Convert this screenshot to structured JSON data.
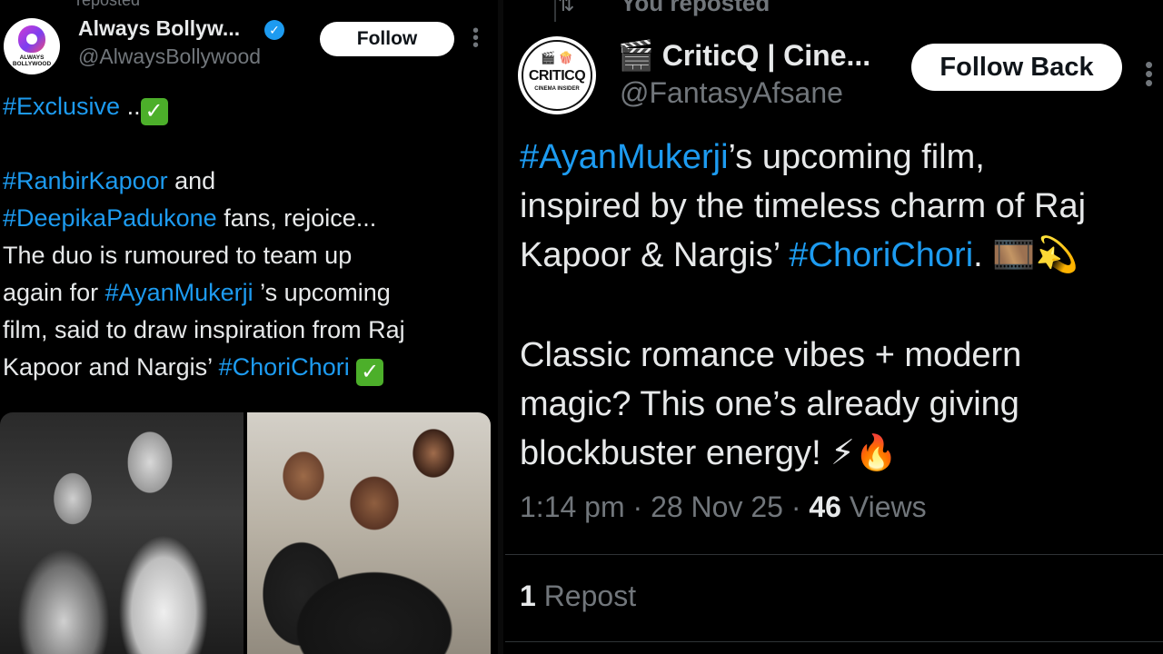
{
  "left_tweet": {
    "header_cut": "reposted",
    "avatar_text": "ALWAYS BOLLYWOOD",
    "name": "Always Bollyw...",
    "verified_icon": "verified-badge",
    "handle": "@AlwaysBollywood",
    "follow_label": "Follow",
    "more_icon": "more-vertical",
    "line1_tag": "#Exclusive",
    "line1_rest": " ..",
    "line2_tag": "#RanbirKapoor",
    "line2_rest": " and",
    "line3_tag": "#DeepikaPadukone",
    "line3_rest": " fans, rejoice...",
    "line4": "The duo is rumoured to team up",
    "line5_pre": "again for ",
    "line5_tag": "#AyanMukerji",
    "line5_rest": " ’s upcoming",
    "line6": "film, said to draw inspiration from Raj",
    "line7_pre": "Kapoor and Nargis’ ",
    "line7_tag": "#ChoriChori",
    "check_mark": "✓"
  },
  "right_tweet": {
    "repost_icon": "repost-icon",
    "reposted_label": "You reposted",
    "avatar_icons": "🎬 🍿",
    "avatar_text": "CRITICQ",
    "avatar_sub": "CINEMA INSIDER",
    "name_emoji": "🎬",
    "name": "CriticQ | Cine...",
    "handle": "@FantasyAfsane",
    "follow_label": "Follow Back",
    "more_icon": "more-vertical",
    "p1_l1_tag": "#AyanMukerji",
    "p1_l1_rest": "’s upcoming film,",
    "p1_l2": "inspired by the timeless charm of Raj",
    "p1_l3_pre": "Kapoor & Nargis’ ",
    "p1_l3_tag": "#ChoriChori",
    "p1_l3_rest": ". 🎞️💫",
    "p2_l1": "Classic romance vibes + modern",
    "p2_l2": "magic? This one’s already giving",
    "p2_l3": "blockbuster energy! ⚡🔥",
    "time": "1:14 pm",
    "dot": " · ",
    "date": "28 Nov 25",
    "views_count": "46",
    "views_label": " Views",
    "reposts_count": "1",
    "reposts_label": " Repost"
  },
  "colors": {
    "background": "#000000",
    "text": "#e7e9ea",
    "muted": "#71767b",
    "hashtag": "#1d9bf0",
    "button_bg": "#ffffff"
  }
}
